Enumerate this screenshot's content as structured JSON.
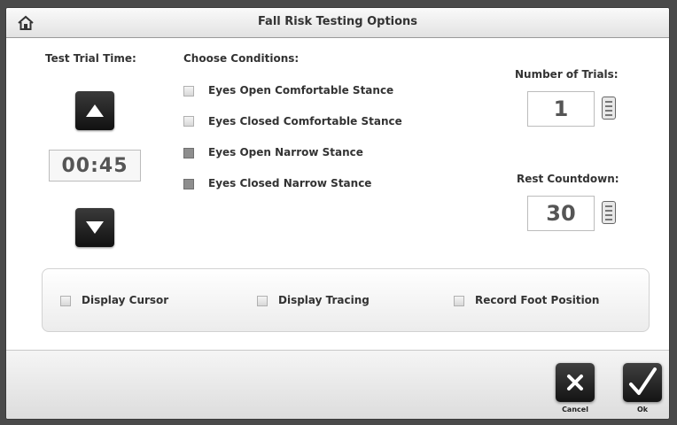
{
  "window": {
    "title": "Fall Risk Testing Options"
  },
  "test_trial": {
    "label": "Test Trial Time:",
    "value": "00:45"
  },
  "conditions": {
    "label": "Choose Conditions:",
    "items": [
      {
        "label": "Eyes Open Comfortable Stance",
        "checked": false
      },
      {
        "label": "Eyes Closed Comfortable Stance",
        "checked": false
      },
      {
        "label": "Eyes Open Narrow Stance",
        "checked": true
      },
      {
        "label": "Eyes Closed Narrow Stance",
        "checked": true
      }
    ]
  },
  "trials": {
    "label": "Number of Trials:",
    "value": "1"
  },
  "rest": {
    "label": "Rest Countdown:",
    "value": "30"
  },
  "display": {
    "cursor": "Display Cursor",
    "tracing": "Display Tracing",
    "foot": "Record Foot Position"
  },
  "actions": {
    "cancel": "Cancel",
    "ok": "Ok"
  }
}
